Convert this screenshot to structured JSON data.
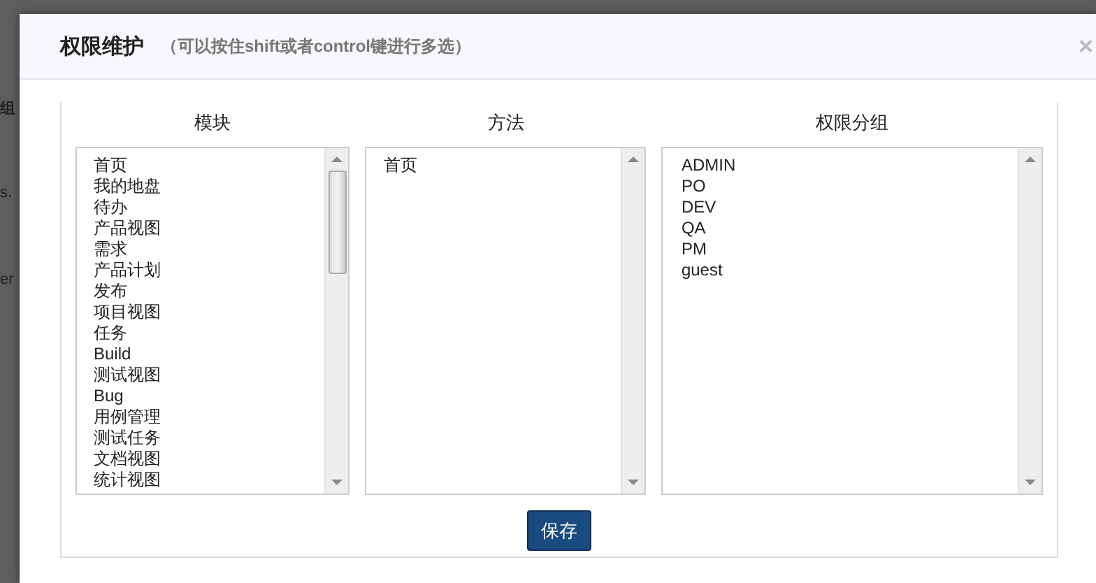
{
  "background_fragments": [
    "组",
    "s.",
    "er"
  ],
  "dialog": {
    "title": "权限维护",
    "hint": "（可以按住shift或者control键进行多选）",
    "close": "×"
  },
  "lists": [
    {
      "heading": "模块",
      "items": [
        "首页",
        "我的地盘",
        "待办",
        "产品视图",
        "需求",
        "产品计划",
        "发布",
        "项目视图",
        "任务",
        "Build",
        "测试视图",
        "Bug",
        "用例管理",
        "测试任务",
        "文档视图",
        "统计视图"
      ],
      "scrollable": true
    },
    {
      "heading": "方法",
      "items": [
        "首页"
      ],
      "scrollable": false
    },
    {
      "heading": "权限分组",
      "items": [
        "ADMIN",
        "PO",
        "DEV",
        "QA",
        "PM",
        "guest"
      ],
      "scrollable": false
    }
  ],
  "buttons": [
    "保存"
  ]
}
